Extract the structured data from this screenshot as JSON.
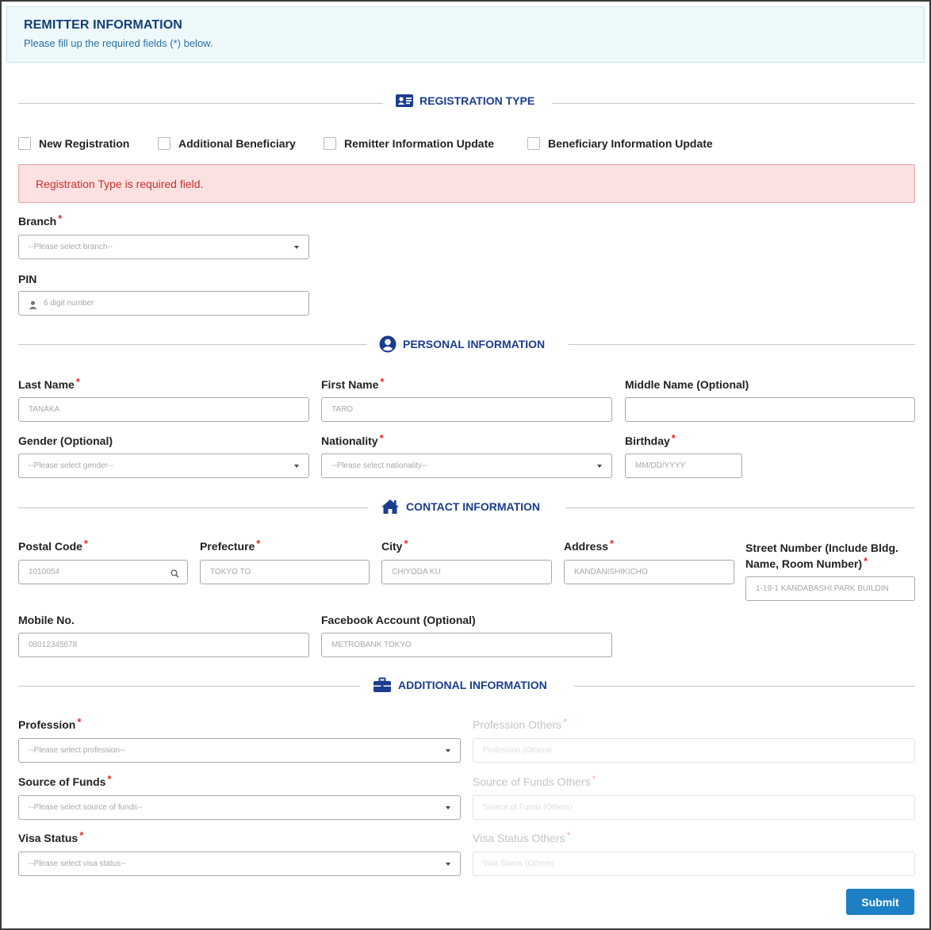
{
  "header": {
    "title": "REMITTER INFORMATION",
    "subtitle": "Please fill up the required fields (*) below."
  },
  "sections": {
    "registration_type": {
      "title": "REGISTRATION TYPE",
      "icon": "id-card-icon"
    },
    "personal": {
      "title": "PERSONAL INFORMATION",
      "icon": "user-circle-icon"
    },
    "contact": {
      "title": "CONTACT INFORMATION",
      "icon": "home-icon"
    },
    "additional": {
      "title": "ADDITIONAL INFORMATION",
      "icon": "briefcase-icon"
    }
  },
  "registration_options": [
    {
      "label": "New Registration",
      "checked": false
    },
    {
      "label": "Additional Beneficiary",
      "checked": false
    },
    {
      "label": "Remitter Information Update",
      "checked": false
    },
    {
      "label": "Beneficiary Information Update",
      "checked": false
    }
  ],
  "alert": {
    "message": "Registration Type is required field."
  },
  "required_mark": "*",
  "fields": {
    "branch": {
      "label": "Branch",
      "placeholder": "--Please select branch--"
    },
    "pin": {
      "label": "PIN",
      "placeholder": "6 digit number"
    },
    "last_name": {
      "label": "Last Name",
      "placeholder": "TANAKA"
    },
    "first_name": {
      "label": "First Name",
      "placeholder": "TARO"
    },
    "middle_name": {
      "label": "Middle Name (Optional)",
      "placeholder": ""
    },
    "gender": {
      "label": "Gender (Optional)",
      "placeholder": "--Please select gender--"
    },
    "nationality": {
      "label": "Nationality",
      "placeholder": "--Please select nationality--"
    },
    "birthday": {
      "label": "Birthday",
      "placeholder": "MM/DD/YYYY"
    },
    "postal_code": {
      "label": "Postal Code",
      "placeholder": "1010054"
    },
    "prefecture": {
      "label": "Prefecture",
      "placeholder": "TOKYO TO"
    },
    "city": {
      "label": "City",
      "placeholder": "CHIYODA KU"
    },
    "address": {
      "label": "Address",
      "placeholder": "KANDANISHIKICHO"
    },
    "street": {
      "label": "Street Number (Include Bldg. Name, Room Number)",
      "placeholder": "1-19-1 KANDABASHI PARK BUILDIN"
    },
    "mobile": {
      "label": "Mobile No.",
      "placeholder": "08012345678"
    },
    "facebook": {
      "label": "Facebook Account (Optional)",
      "placeholder": "METROBANK TOKYO"
    },
    "profession": {
      "label": "Profession",
      "placeholder": "--Please select profession--"
    },
    "profession_others": {
      "label": "Profession Others",
      "placeholder": "Profession (Others)"
    },
    "source_of_funds": {
      "label": "Source of Funds",
      "placeholder": "--Please select source of funds--"
    },
    "source_of_funds_others": {
      "label": "Source of Funds Others",
      "placeholder": "Source of Funds (Others)"
    },
    "visa_status": {
      "label": "Visa Status",
      "placeholder": "--Please select visa status--"
    },
    "visa_status_others": {
      "label": "Visa Status Others",
      "placeholder": "Visa Status (Others)"
    }
  },
  "submit_label": "Submit"
}
